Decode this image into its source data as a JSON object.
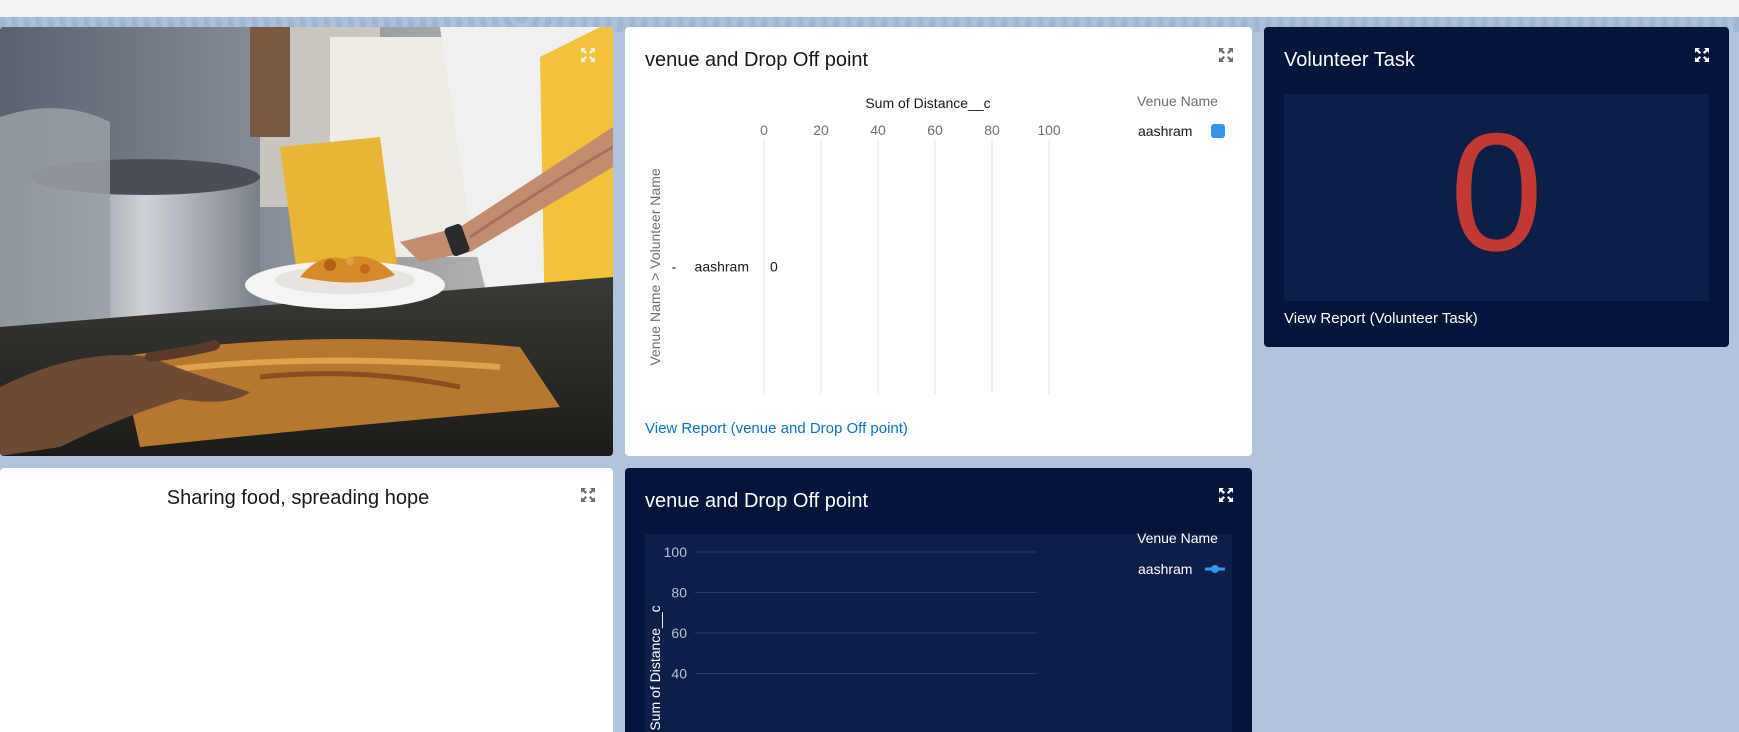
{
  "image_tile": {
    "expand_icon": "expand-icon",
    "slogan": "Sharing food, spreading hope"
  },
  "bar_widget": {
    "title": "venue and Drop Off point",
    "expand_icon": "expand-icon",
    "view_report": "View Report (venue and Drop Off point)",
    "chart_data": {
      "type": "bar",
      "orientation": "horizontal",
      "title": "Sum of Distance__c",
      "ylabel": "Venue Name > Volunteer Name",
      "xlim": [
        0,
        100
      ],
      "xticks": [
        "0",
        "20",
        "40",
        "60",
        "80",
        "100"
      ],
      "categories": [
        "aashram"
      ],
      "category_prefix": "-",
      "series": [
        {
          "name": "aashram",
          "values": [
            0
          ]
        }
      ],
      "data_labels": [
        "0"
      ],
      "legend_title": "Venue Name",
      "legend_position": "top-right",
      "grid": true,
      "colors": {
        "series": "#3296ed"
      }
    }
  },
  "metric_widget": {
    "title": "Volunteer Task",
    "expand_icon": "expand-icon",
    "value": "0",
    "value_color": "#c23934",
    "view_report": "View Report (Volunteer Task)"
  },
  "line_widget": {
    "title": "venue and Drop Off point",
    "expand_icon": "expand-icon",
    "chart_data": {
      "type": "line",
      "ylabel": "Sum of Distance__c",
      "yticks_visible": [
        "100",
        "80",
        "60",
        "40"
      ],
      "ylim": [
        0,
        100
      ],
      "series": [
        {
          "name": "aashram",
          "values": []
        }
      ],
      "legend_title": "Venue Name",
      "legend_position": "top-right",
      "grid": true,
      "colors": {
        "series": "#3296ed",
        "background": "#0c1f49"
      }
    }
  },
  "colors": {
    "page_background": "#b0c4de",
    "dark_card": "#03153a",
    "link": "#0b6fc9",
    "accent_red": "#c23934"
  }
}
